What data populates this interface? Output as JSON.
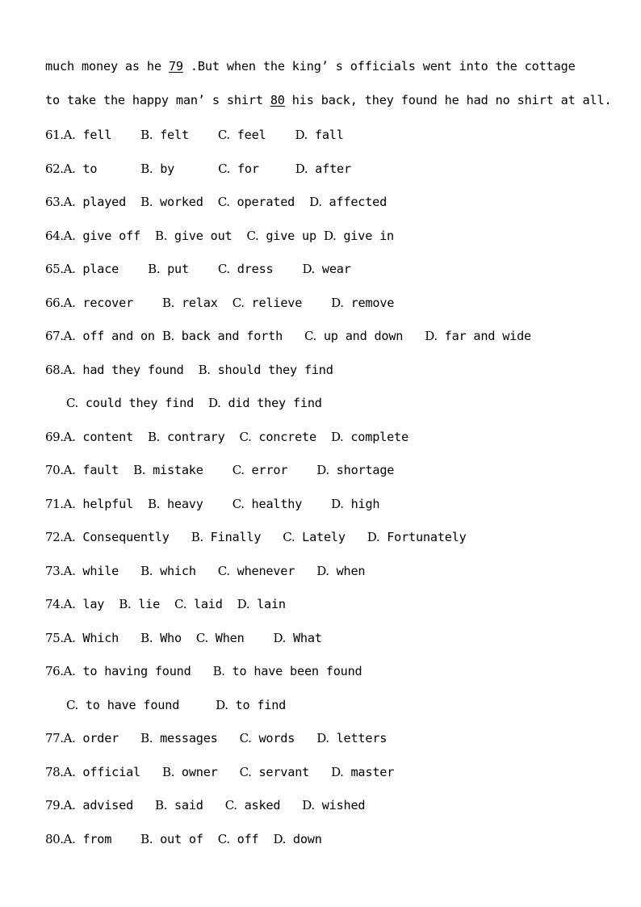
{
  "document": {
    "type": "exam-paper",
    "section": "cloze-test-options",
    "page_background": "#ffffff",
    "text_color": "#000000"
  },
  "passage": {
    "lines": [
      {
        "segments": [
          {
            "text": "much money as he ",
            "underline": false
          },
          {
            "text": "79",
            "underline": true
          },
          {
            "text": " .But when the king’ s officials went into the cottage",
            "underline": false
          }
        ]
      },
      {
        "segments": [
          {
            "text": "to take the happy man’ s shirt ",
            "underline": false
          },
          {
            "text": "80",
            "underline": true
          },
          {
            "text": " his back, they found he had no shirt at all.",
            "underline": false
          }
        ]
      }
    ]
  },
  "questions": [
    {
      "number": "61.",
      "lines": [
        [
          {
            "letter": "A.",
            "text": " fell",
            "gap": "    "
          },
          {
            "letter": "B.",
            "text": " felt",
            "gap": "    "
          },
          {
            "letter": "C.",
            "text": " feel",
            "gap": "    "
          },
          {
            "letter": "D.",
            "text": " fall",
            "gap": ""
          }
        ]
      ]
    },
    {
      "number": "62.",
      "lines": [
        [
          {
            "letter": "A.",
            "text": " to",
            "gap": "      "
          },
          {
            "letter": "B.",
            "text": " by",
            "gap": "      "
          },
          {
            "letter": "C.",
            "text": " for",
            "gap": "     "
          },
          {
            "letter": "D.",
            "text": " after",
            "gap": ""
          }
        ]
      ]
    },
    {
      "number": "63.",
      "lines": [
        [
          {
            "letter": "A.",
            "text": " played",
            "gap": "  "
          },
          {
            "letter": "B.",
            "text": " worked",
            "gap": "  "
          },
          {
            "letter": "C.",
            "text": " operated",
            "gap": "  "
          },
          {
            "letter": "D.",
            "text": " affected",
            "gap": ""
          }
        ]
      ]
    },
    {
      "number": "64.",
      "lines": [
        [
          {
            "letter": "A.",
            "text": " give off",
            "gap": "  "
          },
          {
            "letter": "B.",
            "text": " give out",
            "gap": "  "
          },
          {
            "letter": "C.",
            "text": " give up",
            "gap": " "
          },
          {
            "letter": "D.",
            "text": " give in",
            "gap": ""
          }
        ]
      ]
    },
    {
      "number": "65.",
      "lines": [
        [
          {
            "letter": "A.",
            "text": " place",
            "gap": "    "
          },
          {
            "letter": "B.",
            "text": " put",
            "gap": "    "
          },
          {
            "letter": "C.",
            "text": " dress",
            "gap": "    "
          },
          {
            "letter": "D.",
            "text": " wear",
            "gap": ""
          }
        ]
      ]
    },
    {
      "number": "66.",
      "lines": [
        [
          {
            "letter": "A.",
            "text": " recover",
            "gap": "    "
          },
          {
            "letter": "B.",
            "text": " relax",
            "gap": "  "
          },
          {
            "letter": "C.",
            "text": " relieve",
            "gap": "    "
          },
          {
            "letter": "D.",
            "text": " remove",
            "gap": ""
          }
        ]
      ]
    },
    {
      "number": "67.",
      "lines": [
        [
          {
            "letter": "A.",
            "text": " off and on",
            "gap": " "
          },
          {
            "letter": "B.",
            "text": " back and forth",
            "gap": "   "
          },
          {
            "letter": "C.",
            "text": " up and down",
            "gap": "   "
          },
          {
            "letter": "D.",
            "text": " far and wide",
            "gap": ""
          }
        ]
      ]
    },
    {
      "number": "68.",
      "lines": [
        [
          {
            "letter": "A.",
            "text": " had they found",
            "gap": "  "
          },
          {
            "letter": "B.",
            "text": " should they find",
            "gap": ""
          }
        ],
        [
          {
            "letter": "C.",
            "text": " could they find",
            "gap": "  "
          },
          {
            "letter": "D.",
            "text": " did they find",
            "gap": ""
          }
        ]
      ]
    },
    {
      "number": "69.",
      "lines": [
        [
          {
            "letter": "A.",
            "text": " content",
            "gap": "  "
          },
          {
            "letter": "B.",
            "text": " contrary",
            "gap": "  "
          },
          {
            "letter": "C.",
            "text": " concrete",
            "gap": "  "
          },
          {
            "letter": "D.",
            "text": " complete",
            "gap": ""
          }
        ]
      ]
    },
    {
      "number": "70.",
      "lines": [
        [
          {
            "letter": "A.",
            "text": " fault",
            "gap": "  "
          },
          {
            "letter": "B.",
            "text": " mistake",
            "gap": "    "
          },
          {
            "letter": "C.",
            "text": " error",
            "gap": "    "
          },
          {
            "letter": "D.",
            "text": " shortage",
            "gap": ""
          }
        ]
      ]
    },
    {
      "number": "71.",
      "lines": [
        [
          {
            "letter": "A.",
            "text": " helpful",
            "gap": "  "
          },
          {
            "letter": "B.",
            "text": " heavy",
            "gap": "    "
          },
          {
            "letter": "C.",
            "text": " healthy",
            "gap": "    "
          },
          {
            "letter": "D.",
            "text": " high",
            "gap": ""
          }
        ]
      ]
    },
    {
      "number": "72.",
      "lines": [
        [
          {
            "letter": "A.",
            "text": " Consequently",
            "gap": "   "
          },
          {
            "letter": "B.",
            "text": " Finally",
            "gap": "   "
          },
          {
            "letter": "C.",
            "text": " Lately",
            "gap": "   "
          },
          {
            "letter": "D.",
            "text": " Fortunately",
            "gap": ""
          }
        ]
      ]
    },
    {
      "number": "73.",
      "lines": [
        [
          {
            "letter": "A.",
            "text": " while",
            "gap": "   "
          },
          {
            "letter": "B.",
            "text": " which",
            "gap": "   "
          },
          {
            "letter": "C.",
            "text": " whenever",
            "gap": "   "
          },
          {
            "letter": "D.",
            "text": " when",
            "gap": ""
          }
        ]
      ]
    },
    {
      "number": "74.",
      "lines": [
        [
          {
            "letter": "A.",
            "text": " lay",
            "gap": "  "
          },
          {
            "letter": "B.",
            "text": " lie",
            "gap": "  "
          },
          {
            "letter": "C.",
            "text": " laid",
            "gap": "  "
          },
          {
            "letter": "D.",
            "text": " lain",
            "gap": ""
          }
        ]
      ]
    },
    {
      "number": "75.",
      "lines": [
        [
          {
            "letter": "A.",
            "text": " Which",
            "gap": "   "
          },
          {
            "letter": "B.",
            "text": " Who",
            "gap": "  "
          },
          {
            "letter": "C.",
            "text": " When",
            "gap": "    "
          },
          {
            "letter": "D.",
            "text": " What",
            "gap": ""
          }
        ]
      ]
    },
    {
      "number": "76.",
      "lines": [
        [
          {
            "letter": "A.",
            "text": " to having found",
            "gap": "   "
          },
          {
            "letter": "B.",
            "text": " to have been found",
            "gap": ""
          }
        ],
        [
          {
            "letter": "C.",
            "text": " to have found",
            "gap": "     "
          },
          {
            "letter": "D.",
            "text": " to find",
            "gap": ""
          }
        ]
      ]
    },
    {
      "number": "77.",
      "lines": [
        [
          {
            "letter": "A.",
            "text": " order",
            "gap": "   "
          },
          {
            "letter": "B.",
            "text": " messages",
            "gap": "   "
          },
          {
            "letter": "C.",
            "text": " words",
            "gap": "   "
          },
          {
            "letter": "D.",
            "text": " letters",
            "gap": ""
          }
        ]
      ]
    },
    {
      "number": "78.",
      "lines": [
        [
          {
            "letter": "A.",
            "text": " official",
            "gap": "   "
          },
          {
            "letter": "B.",
            "text": " owner",
            "gap": "   "
          },
          {
            "letter": "C.",
            "text": " servant",
            "gap": "   "
          },
          {
            "letter": "D.",
            "text": " master",
            "gap": ""
          }
        ]
      ]
    },
    {
      "number": "79.",
      "lines": [
        [
          {
            "letter": "A.",
            "text": " advised",
            "gap": "   "
          },
          {
            "letter": "B.",
            "text": " said",
            "gap": "   "
          },
          {
            "letter": "C.",
            "text": " asked",
            "gap": "   "
          },
          {
            "letter": "D.",
            "text": " wished",
            "gap": ""
          }
        ]
      ]
    },
    {
      "number": "80.",
      "lines": [
        [
          {
            "letter": "A.",
            "text": " from",
            "gap": "    "
          },
          {
            "letter": "B.",
            "text": " out of",
            "gap": "  "
          },
          {
            "letter": "C.",
            "text": " off",
            "gap": "  "
          },
          {
            "letter": "D.",
            "text": " down",
            "gap": ""
          }
        ]
      ]
    }
  ]
}
